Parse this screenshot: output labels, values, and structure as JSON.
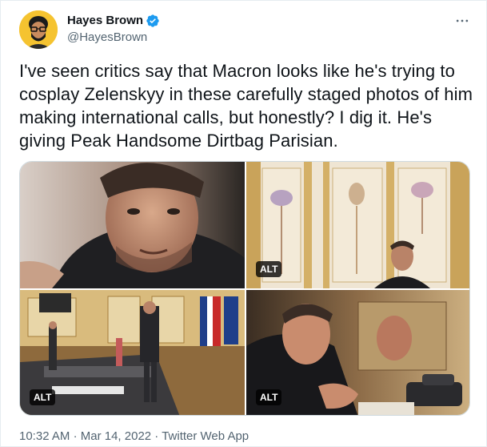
{
  "author": {
    "display_name": "Hayes Brown",
    "handle": "@HayesBrown",
    "avatar_icon": "user-avatar-icon",
    "verified_icon": "verified-badge-icon",
    "verified_color": "#1d9bf0"
  },
  "more_icon": "more-options-icon",
  "tweet": {
    "text": "I've seen critics say that Macron looks like he's trying to cosplay Zelenskyy in these carefully staged photos of him making international calls, but honestly? I dig it. He's giving Peak Handsome Dirtbag Parisian."
  },
  "media": {
    "photos": [
      {
        "alt_badge": ""
      },
      {
        "alt_badge": "ALT"
      },
      {
        "alt_badge": "ALT"
      },
      {
        "alt_badge": "ALT"
      }
    ]
  },
  "meta": {
    "time": "10:32 AM",
    "sep1": "·",
    "date": "Mar 14, 2022",
    "sep2": "·",
    "source": "Twitter Web App"
  },
  "colors": {
    "text_primary": "#0f1419",
    "text_secondary": "#536471",
    "border": "#cfd9de"
  }
}
